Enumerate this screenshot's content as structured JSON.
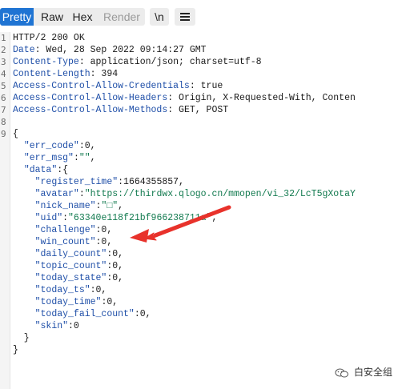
{
  "toolbar": {
    "tabs": [
      "Pretty",
      "Raw",
      "Hex",
      "Render"
    ],
    "newline_label": "\\n",
    "menu_icon": "hamburger-menu-icon"
  },
  "lines": [
    {
      "n": "1",
      "parts": [
        {
          "t": "HTTP/2 200 OK",
          "c": "punc"
        }
      ]
    },
    {
      "n": "2",
      "parts": [
        {
          "t": "Date",
          "c": "hname"
        },
        {
          "t": ": Wed, 28 Sep 2022 09:14:27 GMT",
          "c": "punc"
        }
      ]
    },
    {
      "n": "3",
      "parts": [
        {
          "t": "Content-Type",
          "c": "hname"
        },
        {
          "t": ": application/json; charset=utf-8",
          "c": "punc"
        }
      ]
    },
    {
      "n": "4",
      "parts": [
        {
          "t": "Content-Length",
          "c": "hname"
        },
        {
          "t": ": 394",
          "c": "punc"
        }
      ]
    },
    {
      "n": "5",
      "parts": [
        {
          "t": "Access-Control-Allow-Credentials",
          "c": "hname"
        },
        {
          "t": ": true",
          "c": "punc"
        }
      ]
    },
    {
      "n": "6",
      "parts": [
        {
          "t": "Access-Control-Allow-Headers",
          "c": "hname"
        },
        {
          "t": ": Origin, X-Requested-With, Conten",
          "c": "punc"
        }
      ]
    },
    {
      "n": "7",
      "parts": [
        {
          "t": "Access-Control-Allow-Methods",
          "c": "hname"
        },
        {
          "t": ": GET, POST",
          "c": "punc"
        }
      ]
    },
    {
      "n": "8",
      "parts": [
        {
          "t": "",
          "c": "punc"
        }
      ]
    },
    {
      "n": "9",
      "parts": [
        {
          "t": "{",
          "c": "punc"
        }
      ]
    },
    {
      "n": "",
      "parts": [
        {
          "t": "  ",
          "c": "punc"
        },
        {
          "t": "\"err_code\"",
          "c": "jkey"
        },
        {
          "t": ":0,",
          "c": "punc"
        }
      ]
    },
    {
      "n": "",
      "parts": [
        {
          "t": "  ",
          "c": "punc"
        },
        {
          "t": "\"err_msg\"",
          "c": "jkey"
        },
        {
          "t": ":",
          "c": "punc"
        },
        {
          "t": "\"\"",
          "c": "jstr"
        },
        {
          "t": ",",
          "c": "punc"
        }
      ]
    },
    {
      "n": "",
      "parts": [
        {
          "t": "  ",
          "c": "punc"
        },
        {
          "t": "\"data\"",
          "c": "jkey"
        },
        {
          "t": ":{",
          "c": "punc"
        }
      ]
    },
    {
      "n": "",
      "parts": [
        {
          "t": "    ",
          "c": "punc"
        },
        {
          "t": "\"register_time\"",
          "c": "jkey"
        },
        {
          "t": ":1664355857,",
          "c": "punc"
        }
      ]
    },
    {
      "n": "",
      "parts": [
        {
          "t": "    ",
          "c": "punc"
        },
        {
          "t": "\"avatar\"",
          "c": "jkey"
        },
        {
          "t": ":",
          "c": "punc"
        },
        {
          "t": "\"https://thirdwx.qlogo.cn/mmopen/vi_32/LcT5gXotaY",
          "c": "jstr"
        }
      ]
    },
    {
      "n": "",
      "parts": [
        {
          "t": "    ",
          "c": "punc"
        },
        {
          "t": "\"nick_name\"",
          "c": "jkey"
        },
        {
          "t": ":",
          "c": "punc"
        },
        {
          "t": "\"□\"",
          "c": "jstr"
        },
        {
          "t": ",",
          "c": "punc"
        }
      ]
    },
    {
      "n": "",
      "parts": [
        {
          "t": "    ",
          "c": "punc"
        },
        {
          "t": "\"uid\"",
          "c": "jkey"
        },
        {
          "t": ":",
          "c": "punc"
        },
        {
          "t": "\"63340e118f21bf966238711a\"",
          "c": "jstr"
        },
        {
          "t": ",",
          "c": "punc"
        }
      ]
    },
    {
      "n": "",
      "parts": [
        {
          "t": "    ",
          "c": "punc"
        },
        {
          "t": "\"challenge\"",
          "c": "jkey"
        },
        {
          "t": ":0,",
          "c": "punc"
        }
      ]
    },
    {
      "n": "",
      "parts": [
        {
          "t": "    ",
          "c": "punc"
        },
        {
          "t": "\"win_count\"",
          "c": "jkey"
        },
        {
          "t": ":0,",
          "c": "punc"
        }
      ]
    },
    {
      "n": "",
      "parts": [
        {
          "t": "    ",
          "c": "punc"
        },
        {
          "t": "\"daily_count\"",
          "c": "jkey"
        },
        {
          "t": ":0,",
          "c": "punc"
        }
      ]
    },
    {
      "n": "",
      "parts": [
        {
          "t": "    ",
          "c": "punc"
        },
        {
          "t": "\"topic_count\"",
          "c": "jkey"
        },
        {
          "t": ":0,",
          "c": "punc"
        }
      ]
    },
    {
      "n": "",
      "parts": [
        {
          "t": "    ",
          "c": "punc"
        },
        {
          "t": "\"today_state\"",
          "c": "jkey"
        },
        {
          "t": ":0,",
          "c": "punc"
        }
      ]
    },
    {
      "n": "",
      "parts": [
        {
          "t": "    ",
          "c": "punc"
        },
        {
          "t": "\"today_ts\"",
          "c": "jkey"
        },
        {
          "t": ":0,",
          "c": "punc"
        }
      ]
    },
    {
      "n": "",
      "parts": [
        {
          "t": "    ",
          "c": "punc"
        },
        {
          "t": "\"today_time\"",
          "c": "jkey"
        },
        {
          "t": ":0,",
          "c": "punc"
        }
      ]
    },
    {
      "n": "",
      "parts": [
        {
          "t": "    ",
          "c": "punc"
        },
        {
          "t": "\"today_fail_count\"",
          "c": "jkey"
        },
        {
          "t": ":0,",
          "c": "punc"
        }
      ]
    },
    {
      "n": "",
      "parts": [
        {
          "t": "    ",
          "c": "punc"
        },
        {
          "t": "\"skin\"",
          "c": "jkey"
        },
        {
          "t": ":0",
          "c": "punc"
        }
      ]
    },
    {
      "n": "",
      "parts": [
        {
          "t": "  }",
          "c": "punc"
        }
      ]
    },
    {
      "n": "",
      "parts": [
        {
          "t": "}",
          "c": "punc"
        }
      ]
    }
  ],
  "annotation": {
    "icon": "red-arrow-icon",
    "color": "#e8322b"
  },
  "watermark": {
    "icon": "wechat-icon",
    "text": "白安全组"
  },
  "colors": {
    "active_tab": "#1f74d3",
    "header_name": "#1f4fa8",
    "json_string": "#127a4f"
  }
}
